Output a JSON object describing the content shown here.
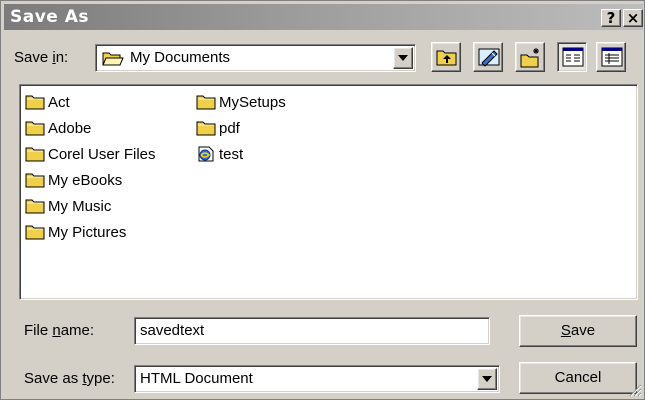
{
  "window": {
    "title": "Save As",
    "help_label": "?",
    "close_label": "×"
  },
  "save_in": {
    "label_prefix": "Save ",
    "label_hotkey": "i",
    "label_suffix": "n:",
    "value": "My Documents"
  },
  "toolbar": [
    "up-one-level",
    "desktop",
    "create-new-folder",
    "list-view",
    "details-view"
  ],
  "files": [
    {
      "name": "Act",
      "icon": "folder-icon"
    },
    {
      "name": "Adobe",
      "icon": "folder-icon"
    },
    {
      "name": "Corel User Files",
      "icon": "folder-icon"
    },
    {
      "name": "My eBooks",
      "icon": "folder-icon"
    },
    {
      "name": "My Music",
      "icon": "folder-icon"
    },
    {
      "name": "My Pictures",
      "icon": "folder-icon"
    },
    {
      "name": "MySetups",
      "icon": "folder-icon"
    },
    {
      "name": "pdf",
      "icon": "folder-icon"
    },
    {
      "name": "test",
      "icon": "html-file-icon"
    }
  ],
  "file_name": {
    "label_prefix": "File ",
    "label_hotkey": "n",
    "label_suffix": "ame:",
    "value": "savedtext"
  },
  "save_as_type": {
    "label_prefix": "Save as ",
    "label_hotkey": "t",
    "label_suffix": "ype:",
    "value": "HTML Document"
  },
  "buttons": {
    "save_hotkey": "S",
    "save_rest": "ave",
    "cancel_label": "Cancel"
  },
  "colors": {
    "face": "#d4d0c8",
    "folder": "#f0d048"
  }
}
